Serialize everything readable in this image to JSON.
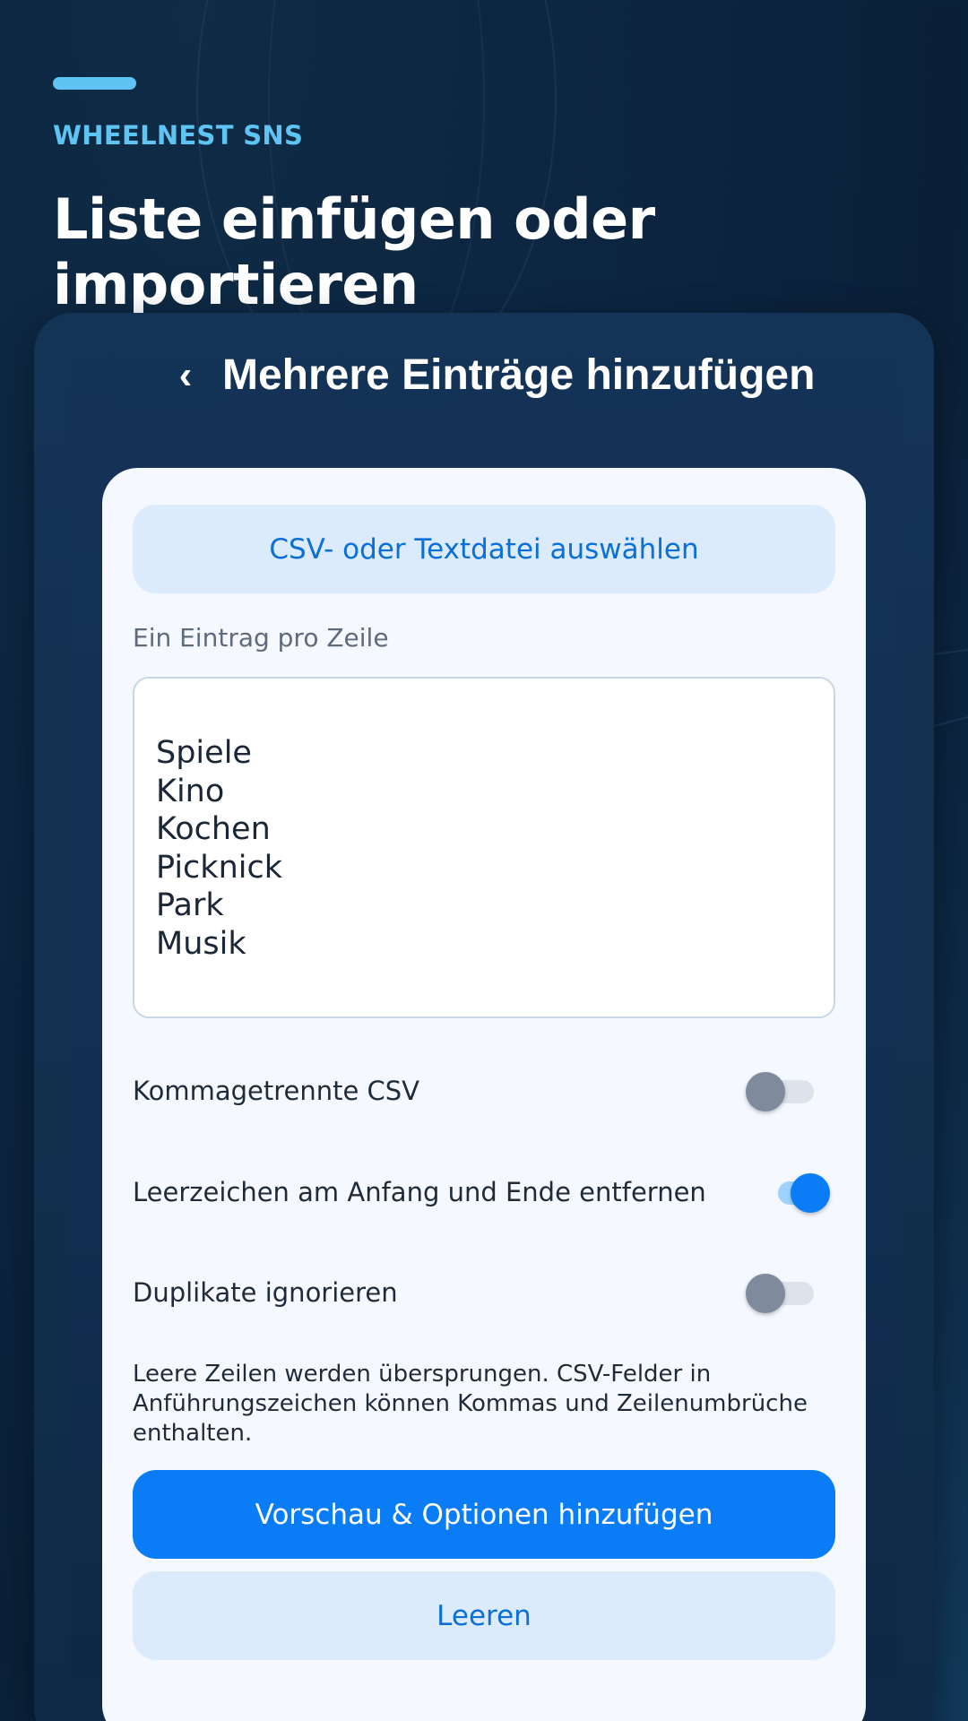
{
  "header": {
    "brand": "WHEELNEST SNS",
    "title": "Liste einfügen oder importieren"
  },
  "screen": {
    "back_icon": "‹",
    "title": "Mehrere Einträge hinzufügen"
  },
  "form": {
    "select_file_label": "CSV- oder Textdatei auswählen",
    "helper_label": "Ein Eintrag pro Zeile",
    "entries_text": "Spiele\nKino\nKochen\nPicknick\nPark\nMusik",
    "options": [
      {
        "label": "Kommagetrennte CSV",
        "enabled": false
      },
      {
        "label": "Leerzeichen am Anfang und Ende entfernen",
        "enabled": true
      },
      {
        "label": "Duplikate ignorieren",
        "enabled": false
      }
    ],
    "note": "Leere Zeilen werden übersprungen. CSV-Felder in Anführungszeichen können Kommas und Zeilenumbrüche enthalten.",
    "preview_button_label": "Vorschau & Optionen hinzufügen",
    "clear_button_label": "Leeren"
  },
  "colors": {
    "accent": "#0a7cf5",
    "brand": "#5ec4f4",
    "background": "#0c2440",
    "card": "#f5f9ff",
    "secondary_button": "#dcebfc"
  }
}
